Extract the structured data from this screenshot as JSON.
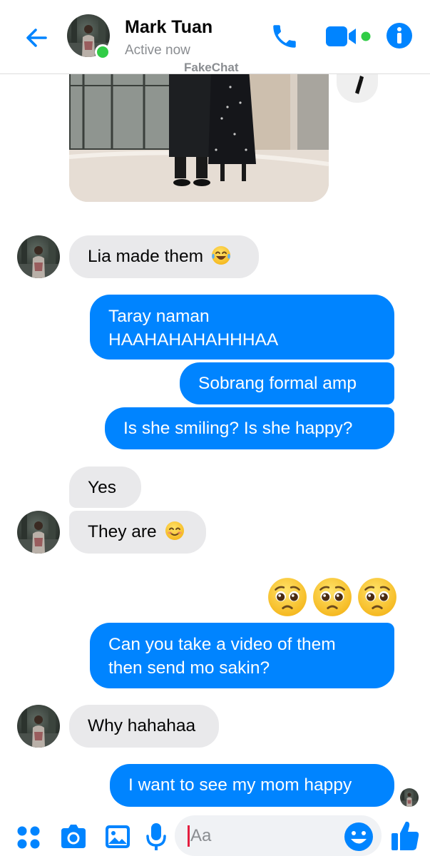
{
  "watermark": "FakeChat",
  "header": {
    "contact_name": "Mark Tuan",
    "status": "Active now",
    "icons": [
      "back-arrow-icon",
      "phone-icon",
      "video-camera-icon",
      "info-icon"
    ],
    "online_color": "#31cc46"
  },
  "theme": {
    "accent": "#0084ff",
    "incoming_bubble": "#e9e9eb",
    "outgoing_bubble": "#0084ff"
  },
  "messages": [
    {
      "from": "contact",
      "text": "Lia made them",
      "emoji": "laughing-tears-emoji"
    },
    {
      "from": "me",
      "lines": [
        "Taray naman",
        "HAAHAHAHAHHHAA"
      ]
    },
    {
      "from": "me",
      "text": "Sobrang formal amp"
    },
    {
      "from": "me",
      "text": "Is she smiling? Is she happy?"
    },
    {
      "from": "contact",
      "text": "Yes"
    },
    {
      "from": "contact",
      "text": "They are",
      "emoji": "smiling-emoji"
    },
    {
      "from": "me",
      "emojis": [
        "pleading-face-emoji",
        "pleading-face-emoji",
        "pleading-face-emoji"
      ]
    },
    {
      "from": "me",
      "lines": [
        "Can you take a video of them",
        "then send mo sakin?"
      ]
    },
    {
      "from": "contact",
      "text": "Why hahahaa"
    },
    {
      "from": "me",
      "text": "I want to see my mom happy"
    }
  ],
  "composer": {
    "placeholder": "Aa",
    "icons": [
      "apps-grid-icon",
      "camera-icon",
      "gallery-icon",
      "microphone-icon",
      "emoji-icon",
      "thumbs-up-icon"
    ]
  }
}
